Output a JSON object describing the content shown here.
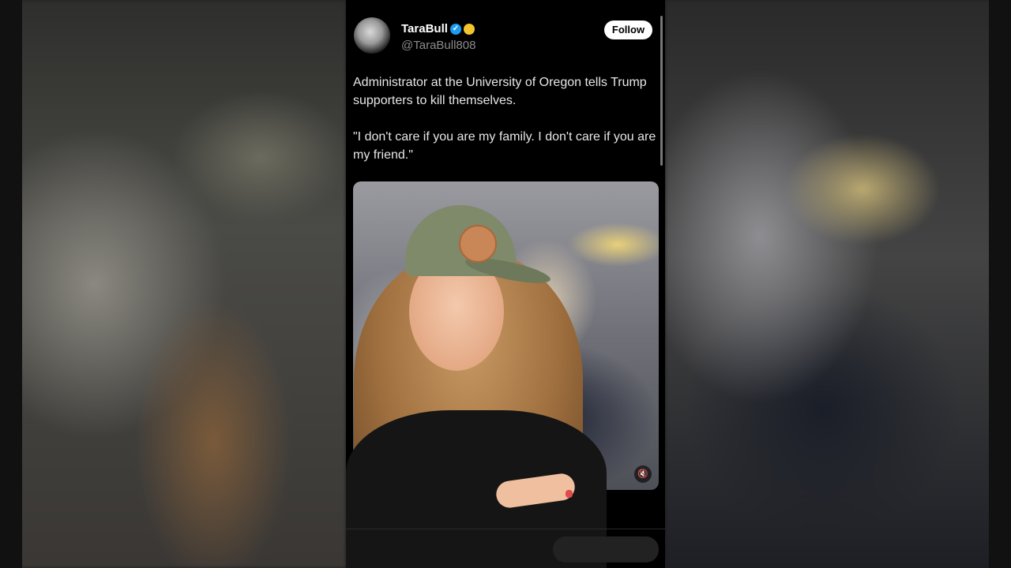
{
  "tweet": {
    "display_name": "TaraBull",
    "handle": "@TaraBull808",
    "follow_label": "Follow",
    "verified_icon": "verified-check-icon",
    "badge_icon": "yellow-badge-icon",
    "paragraphs": [
      "Administrator at the University of Oregon tells Trump supporters to kill themselves.",
      "\"I don't care if you are my family. I don't care if you are my friend.\""
    ]
  },
  "media": {
    "mute_icon": "mute-icon"
  },
  "colors": {
    "background": "#000000",
    "text": "#e7e7e7",
    "handle": "#8b8b8b",
    "verified": "#1d9bf0"
  }
}
